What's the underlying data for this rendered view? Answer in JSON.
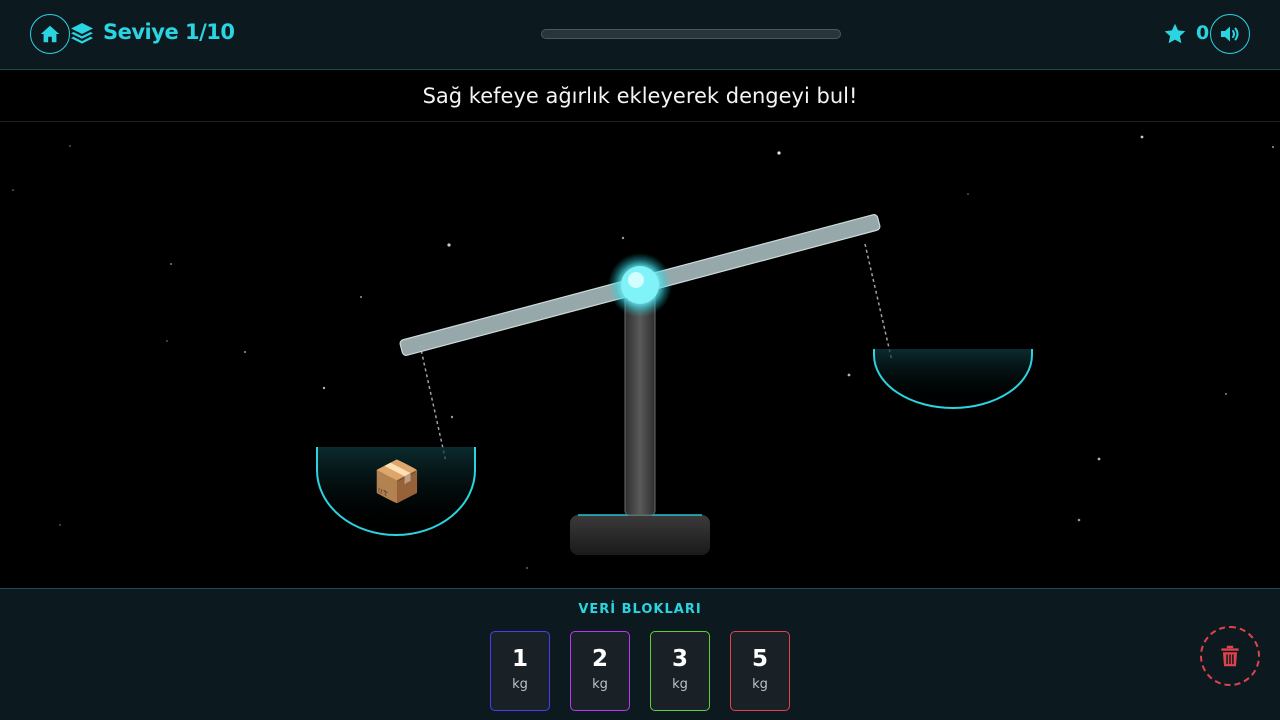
{
  "header": {
    "home_icon": "home-icon",
    "level_icon": "layers-icon",
    "level_label": "Seviye 1/10",
    "level_progress": 0,
    "score_icon": "star-icon",
    "score": "0",
    "sound_icon": "volume-icon"
  },
  "instruction": "Sağ kefeye ağırlık ekleyerek dengeyi bul!",
  "scale": {
    "left_pan_items": [
      {
        "icon": "package-icon",
        "glyph": "📦"
      }
    ],
    "right_pan_items": []
  },
  "palette": {
    "title": "VERİ BLOKLARI",
    "blocks": [
      {
        "value": "1",
        "unit": "kg",
        "color": "#4a3df0"
      },
      {
        "value": "2",
        "unit": "kg",
        "color": "#b43cf0"
      },
      {
        "value": "3",
        "unit": "kg",
        "color": "#5fcf3e"
      },
      {
        "value": "5",
        "unit": "kg",
        "color": "#e0434c"
      }
    ],
    "trash_icon": "trash-icon"
  },
  "colors": {
    "accent": "#2ad4e0",
    "panel": "#0c1a20",
    "danger": "#e0434c"
  }
}
